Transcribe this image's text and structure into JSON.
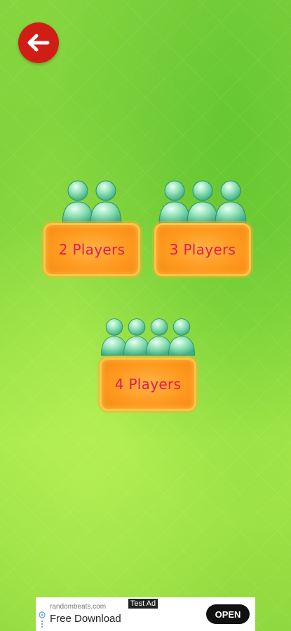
{
  "navigation": {
    "back_icon": "arrow-left-icon"
  },
  "options": [
    {
      "label": "2 Players",
      "players": 2,
      "icon": "player-figure-icon"
    },
    {
      "label": "3 Players",
      "players": 3,
      "icon": "player-figure-icon"
    },
    {
      "label": "4 Players",
      "players": 4,
      "icon": "player-figure-icon"
    }
  ],
  "ad": {
    "source": "randombeats.com",
    "tag": "Test Ad",
    "title": "Free Download",
    "cta": "OPEN"
  },
  "colors": {
    "back_button": "#d01e17",
    "button_fill": "#ff9a1f",
    "button_text": "#e8174f",
    "figure": "#7ed8a6"
  }
}
